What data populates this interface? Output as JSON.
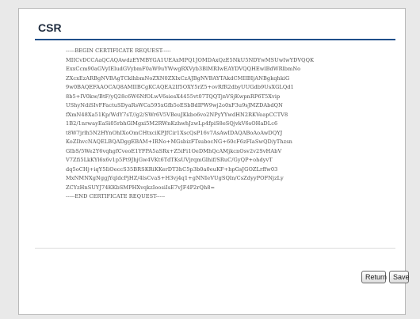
{
  "header": {
    "title": "CSR"
  },
  "csr": {
    "text": "-----BEGIN CERTIFICATE REQUEST-----\nMIICvDCCAaQCAQAwdzEYMBYGA1UEAxMPQ1JOMDAxQzE5NkU5NDYwMSUwIwYDVQQK\nExxCcm90aGVyIEludGVybmF0aW9uYWwgRXVyb3BlMRIwEAYDVQQHEwlBdWRlbmNo\nZXcxEzARBgNVBAgTCklhbmNoZXN0ZXIxCzAJBgNVBAYTAkdCMIIBIjANBgkqhkiG\n9w0BAQEFAAOCAQ8AMIIBCgKCAQEA2If5OXY5rZ5+ovRfR2dbyUUGdb9UsXGLQd1\n8b5+IV0kw/BtF/yQ28c6W6NfOLwV6siesX4455vt07TQQTjnVSjKwpnRP6T5Xvip\nUShyNdiSIvFFactuSDyaRsWCa595xGfb5oESbBdIPW9wj2o0xF3u9sJMZDAbdQN\nfXmN48Xa51Kp/WdY7sT//g2/SWr6V5VBeuJKkbo6vo2NPyYYwdHN2RKVeapCCTV8\n1B2/1nrwayEaSi05rbhGlMgxi5M2RWnKzhwhJzwLp4fpiS8eSQjvkV6sOHaDLc6\nt8W7jrlh5N2HYnOhIXoOmCHtxciKPJfCir1XscQsP16v7AsAwIDAQABoAoAwDQYJ\nKoZIhvcNAQELBQADggEBAM+IRNo+MGsbizFTsubocNG+60cF6zFIaSwQD/yThzsn\nGIbS/5We2Y6vqhgfCveoE1YFPA5aSRx+Z5iFi1OeDMhQcAMjkcnOsv2v2SvHAbV\nV7Zfi5LkKYl6x6v1p5Pt9JhjGw4VKt6TdTKsUVjrqmGlhif/SRuC/GyQP+ohdyvT\ndq5oCHj+iqY5IiOeccS35BRSKRiKKerDT3hC5p3b0a0euKF+hpGsJGOZLrffw03\nMxNMNXgNggjYqldcPjHZ/4lsCvaS+H3vj4q1+gNNIeVUgSQln/CsZdyyPOFNjzLy\nZCYzHnSUYJ74KKbSMPHXvqkzIoosiIsE7vJF4P2rQh8=\n-----END CERTIFICATE REQUEST-----"
  },
  "buttons": {
    "return_label": "Return",
    "save_label": "Save"
  },
  "colors": {
    "title_rule": "#1f4f8a",
    "page_background": "#e9e9e9",
    "panel_background": "#ffffff"
  }
}
